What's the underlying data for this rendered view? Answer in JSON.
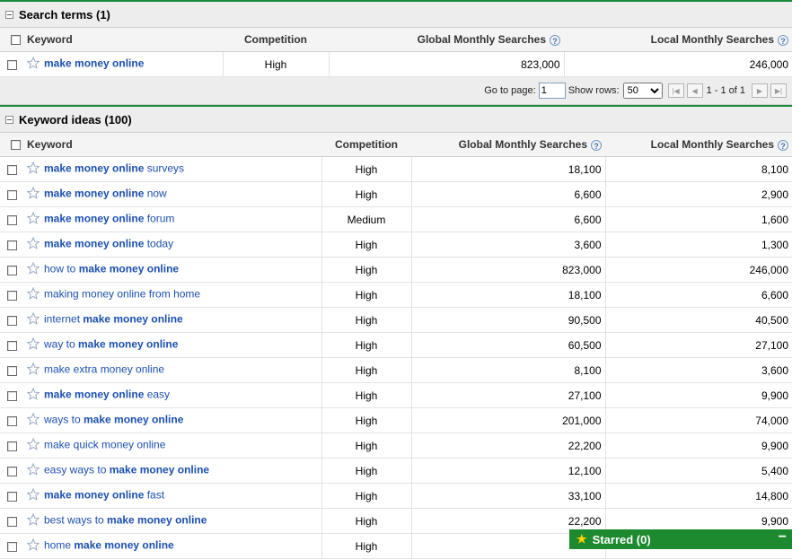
{
  "search_terms": {
    "title": "Search terms (1)",
    "columns": [
      "Keyword",
      "Competition",
      "Global Monthly Searches",
      "Local Monthly Searches"
    ],
    "rows": [
      {
        "pre": "",
        "bold": "make money online",
        "post": "",
        "competition": "High",
        "global": "823,000",
        "local": "246,000"
      }
    ]
  },
  "pager": {
    "go_to_page_label": "Go to page:",
    "page_value": "1",
    "show_rows_label": "Show rows:",
    "rows_value": "50",
    "range_text": "1 - 1 of 1"
  },
  "keyword_ideas": {
    "title": "Keyword ideas (100)",
    "columns": [
      "Keyword",
      "Competition",
      "Global Monthly Searches",
      "Local Monthly Searches"
    ],
    "rows": [
      {
        "pre": "",
        "bold": "make money online",
        "post": " surveys",
        "competition": "High",
        "global": "18,100",
        "local": "8,100"
      },
      {
        "pre": "",
        "bold": "make money online",
        "post": " now",
        "competition": "High",
        "global": "6,600",
        "local": "2,900"
      },
      {
        "pre": "",
        "bold": "make money online",
        "post": " forum",
        "competition": "Medium",
        "global": "6,600",
        "local": "1,600"
      },
      {
        "pre": "",
        "bold": "make money online",
        "post": " today",
        "competition": "High",
        "global": "3,600",
        "local": "1,300"
      },
      {
        "pre": "how to ",
        "bold": "make money online",
        "post": "",
        "competition": "High",
        "global": "823,000",
        "local": "246,000"
      },
      {
        "pre": "making money online from home",
        "bold": "",
        "post": "",
        "competition": "High",
        "global": "18,100",
        "local": "6,600"
      },
      {
        "pre": "internet ",
        "bold": "make money online",
        "post": "",
        "competition": "High",
        "global": "90,500",
        "local": "40,500"
      },
      {
        "pre": "way to ",
        "bold": "make money online",
        "post": "",
        "competition": "High",
        "global": "60,500",
        "local": "27,100"
      },
      {
        "pre": "make extra money online",
        "bold": "",
        "post": "",
        "competition": "High",
        "global": "8,100",
        "local": "3,600"
      },
      {
        "pre": "",
        "bold": "make money online",
        "post": " easy",
        "competition": "High",
        "global": "27,100",
        "local": "9,900"
      },
      {
        "pre": "ways to ",
        "bold": "make money online",
        "post": "",
        "competition": "High",
        "global": "201,000",
        "local": "74,000"
      },
      {
        "pre": "make quick money online",
        "bold": "",
        "post": "",
        "competition": "High",
        "global": "22,200",
        "local": "9,900"
      },
      {
        "pre": "easy ways to ",
        "bold": "make money online",
        "post": "",
        "competition": "High",
        "global": "12,100",
        "local": "5,400"
      },
      {
        "pre": "",
        "bold": "make money online",
        "post": " fast",
        "competition": "High",
        "global": "33,100",
        "local": "14,800"
      },
      {
        "pre": "best ways to ",
        "bold": "make money online",
        "post": "",
        "competition": "High",
        "global": "22,200",
        "local": "9,900"
      },
      {
        "pre": "home ",
        "bold": "make money online",
        "post": "",
        "competition": "High",
        "global": "",
        "local": ""
      }
    ]
  },
  "starred_bar": {
    "label": "Starred (0)",
    "minimize": "−"
  },
  "help_glyph": "?",
  "colors": {
    "accent_green": "#1b8a3a",
    "link_blue": "#1a4fb0"
  }
}
